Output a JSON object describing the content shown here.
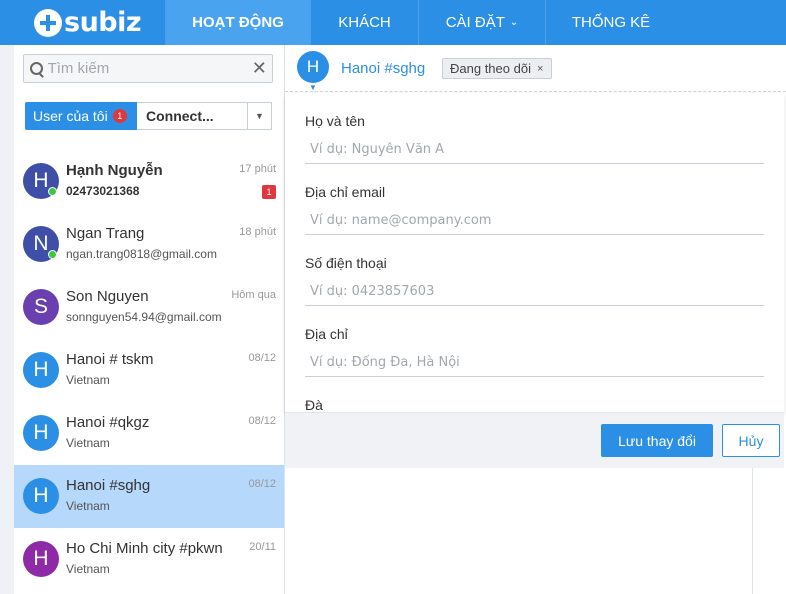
{
  "app": {
    "logo_text": "subiz",
    "nav": [
      {
        "label": "HOẠT ĐỘNG"
      },
      {
        "label": "KHÁCH"
      },
      {
        "label": "CÀI ĐẶT"
      },
      {
        "label": "THỐNG KÊ"
      }
    ],
    "nav_chevron": "⌄"
  },
  "sidebar": {
    "search": {
      "placeholder": "Tìm kiếm",
      "clear": "✕"
    },
    "filter": {
      "mine_label": "User của tôi",
      "mine_badge": "1",
      "connect_label": "Connect...",
      "dropdown": "▼"
    },
    "conversations": [
      {
        "initial": "H",
        "name": "Hạnh Nguyễn",
        "sub": "02473021368",
        "time": "17 phút",
        "badge": "1",
        "color": "#3f4fa8",
        "online": true,
        "bold": true
      },
      {
        "initial": "N",
        "name": "Ngan Trang",
        "sub": "ngan.trang0818@gmail.com",
        "time": "18 phút",
        "badge": "",
        "color": "#3f4fa8",
        "online": true,
        "bold": false
      },
      {
        "initial": "S",
        "name": "Son Nguyen",
        "sub": "sonnguyen54.94@gmail.com",
        "time": "Hôm qua",
        "badge": "",
        "color": "#6a3fb0",
        "online": false,
        "bold": false
      },
      {
        "initial": "H",
        "name": "Hanoi # tskm",
        "sub": "Vietnam",
        "time": "08/12",
        "badge": "",
        "color": "#2b8fe6",
        "online": false,
        "bold": false
      },
      {
        "initial": "H",
        "name": "Hanoi #qkgz",
        "sub": "Vietnam",
        "time": "08/12",
        "badge": "",
        "color": "#2b8fe6",
        "online": false,
        "bold": false
      },
      {
        "initial": "H",
        "name": "Hanoi #sghg",
        "sub": "Vietnam",
        "time": "08/12",
        "badge": "",
        "color": "#2b8fe6",
        "online": false,
        "bold": false,
        "selected": true
      },
      {
        "initial": "H",
        "name": "Ho Chi Minh city #pkwn",
        "sub": "Vietnam",
        "time": "20/11",
        "badge": "",
        "color": "#8e2aa6",
        "online": false,
        "bold": false
      }
    ]
  },
  "main": {
    "header": {
      "avatar_initial": "H",
      "name": "Hanoi #sghg",
      "follow_label": "Đang theo dõi",
      "follow_close": "×",
      "caret": "▼"
    },
    "form": {
      "fields": [
        {
          "label": "Họ và tên",
          "placeholder": "Ví dụ: Nguyễn Văn A"
        },
        {
          "label": "Địa chỉ email",
          "placeholder": "Ví dụ: name@company.com"
        },
        {
          "label": "Số điện thoại",
          "placeholder": "Ví dụ: 0423857603"
        },
        {
          "label": "Địa chỉ",
          "placeholder": "Ví dụ: Đống Đa, Hà Nội"
        },
        {
          "label": "Đà",
          "placeholder": ""
        }
      ],
      "save_label": "Lưu thay đổi",
      "cancel_label": "Hủy"
    }
  }
}
